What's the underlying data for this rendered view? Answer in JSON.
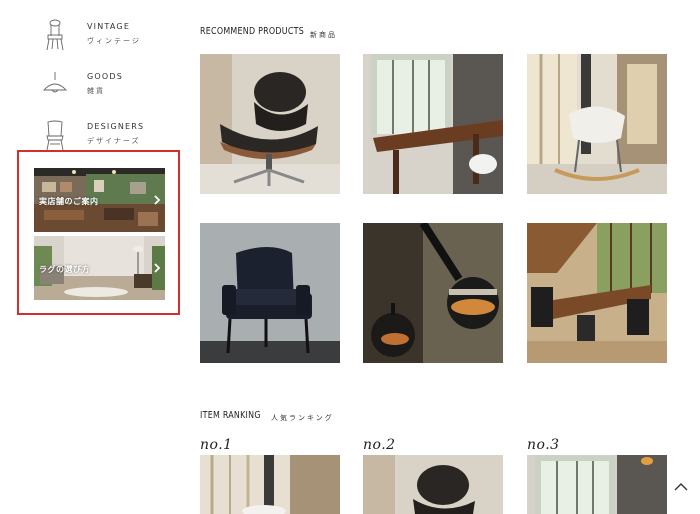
{
  "sidebar": {
    "categories": [
      {
        "en": "VINTAGE",
        "jp": "ヴィンテージ",
        "icon": "chair-icon"
      },
      {
        "en": "GOODS",
        "jp": "雑貨",
        "icon": "lamp-icon"
      },
      {
        "en": "DESIGNERS",
        "jp": "デザイナーズ",
        "icon": "designer-chair-icon"
      }
    ],
    "banners": [
      {
        "label": "実店舗のご案内"
      },
      {
        "label": "ラグの選び方"
      }
    ]
  },
  "recommend": {
    "title": "RECOMMEND PRODUCTS",
    "subtitle": "新商品"
  },
  "ranking": {
    "title": "ITEM RANKING",
    "subtitle": "人気ランキング",
    "ranks": [
      "no.1",
      "no.2",
      "no.3"
    ]
  },
  "colors": {
    "highlight": "#d32f2f",
    "banner1_wall": "#5f7a4e",
    "banner2_wall": "#d9d4cb"
  }
}
